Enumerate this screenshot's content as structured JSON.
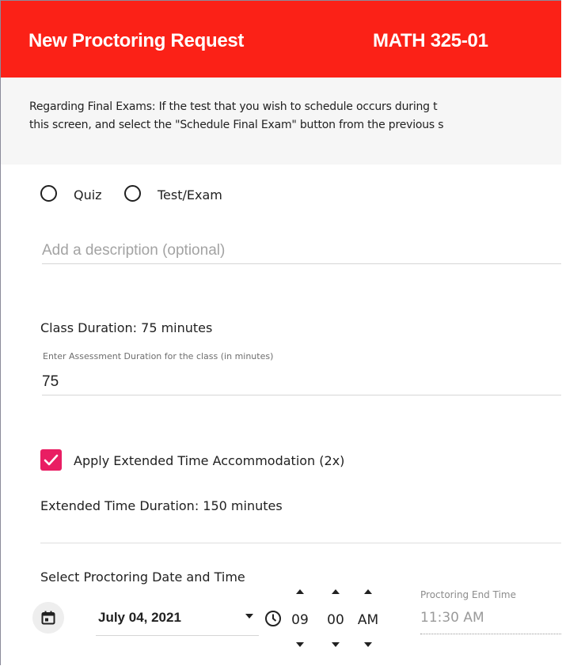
{
  "header": {
    "title": "New Proctoring Request",
    "course": "MATH 325-01"
  },
  "notice": {
    "line1": "Regarding Final Exams: If the test that you wish to schedule occurs during t",
    "line2": "this screen, and select the \"Schedule Final Exam\" button from the previous s"
  },
  "assessment_type": {
    "options": [
      {
        "label": "Quiz",
        "selected": false
      },
      {
        "label": "Test/Exam",
        "selected": false
      }
    ]
  },
  "description": {
    "placeholder": "Add a description (optional)",
    "value": ""
  },
  "duration": {
    "class_duration_text": "Class Duration: 75 minutes",
    "assessment_label": "Enter Assessment Duration for the class (in minutes)",
    "assessment_value": "75"
  },
  "extended_time": {
    "checked": true,
    "label": "Apply Extended Time Accommodation (2x)",
    "duration_text": "Extended Time Duration: 150 minutes"
  },
  "schedule": {
    "section_label": "Select Proctoring Date and Time",
    "date": "July 04, 2021",
    "time": {
      "hour": "09",
      "minute": "00",
      "meridiem": "AM"
    },
    "end_time_label": "Proctoring End Time",
    "end_time_value": "11:30 AM"
  },
  "icons": {
    "calendar": "calendar-icon",
    "clock": "clock-icon",
    "dropdown": "caret-down-icon",
    "check": "check-icon"
  },
  "colors": {
    "header_bg": "#fb2117",
    "checkbox_accent": "#e91e63",
    "notice_bg": "#f6f6f6"
  }
}
